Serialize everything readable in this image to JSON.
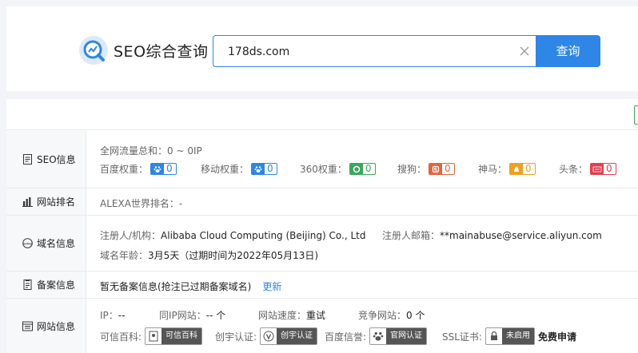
{
  "header": {
    "logo_text": "SEO综合查询",
    "search_value": "178ds.com",
    "search_button": "查询"
  },
  "seo": {
    "label": "SEO信息",
    "traffic_label": "全网流量总和：",
    "traffic_value": "0 ~ 0IP",
    "weights": [
      {
        "label": "百度权重：",
        "value": "0",
        "color": "#2e86e6",
        "icon": "baidu-paw-icon"
      },
      {
        "label": "移动权重：",
        "value": "0",
        "color": "#2e86e6",
        "icon": "mobile-paw-icon"
      },
      {
        "label": "360权重：",
        "value": "0",
        "color": "#3aa85a",
        "icon": "360-icon"
      },
      {
        "label": "搜狗：",
        "value": "0",
        "color": "#e8623a",
        "icon": "sogou-icon"
      },
      {
        "label": "神马：",
        "value": "0",
        "color": "#f0a020",
        "icon": "shenma-icon"
      },
      {
        "label": "头条：",
        "value": "0",
        "color": "#e04050",
        "icon": "toutiao-icon"
      }
    ]
  },
  "rank": {
    "label": "网站排名",
    "alexa_label": "ALEXA世界排名：",
    "alexa_value": "-"
  },
  "domain": {
    "label": "域名信息",
    "registrant_label": "注册人/机构：",
    "registrant_value": "Alibaba Cloud Computing (Beijing) Co., Ltd",
    "email_label": "注册人邮箱：",
    "email_value": "**mainabuse@service.aliyun.com",
    "age_label": "域名年龄：",
    "age_value": "3月5天（过期时间为2022年05月13日)"
  },
  "icp": {
    "label": "备案信息",
    "status": "暂无备案信息(抢注已过期备案域名)",
    "refresh": "更新"
  },
  "site": {
    "label": "网站信息",
    "ip_label": "IP：",
    "ip_value": "--",
    "same_ip_label": "同IP网站：",
    "same_ip_value": "-- 个",
    "speed_label": "网站速度：",
    "speed_value": "重试",
    "competitor_label": "竞争网站：",
    "competitor_value": "0 个",
    "baike_label": "可信百科:",
    "baike_badge": "可信百科",
    "chuangyu_label": "创宇认证:",
    "chuangyu_badge": "创宇认证",
    "baidu_credit_label": "百度信誉:",
    "baidu_credit_badge": "官网认证",
    "ssl_label": "SSL证书:",
    "ssl_badge": "未启用",
    "ssl_apply": "免费申请"
  }
}
